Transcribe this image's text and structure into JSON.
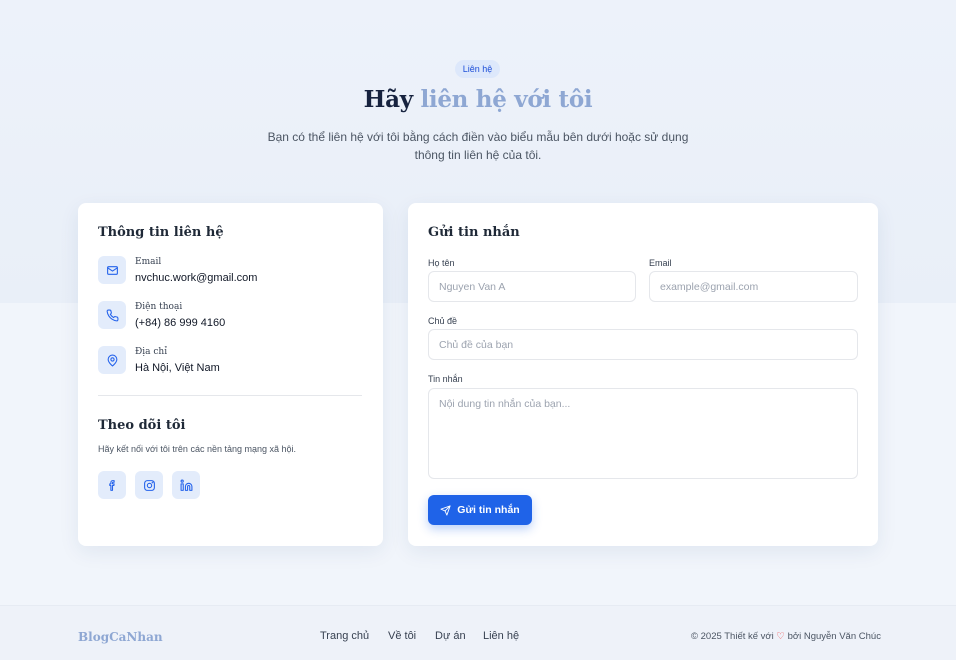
{
  "hero": {
    "badge": "Liên hệ",
    "title_plain": "Hãy ",
    "title_accent": "liên hệ với tôi",
    "subtitle_line1": "Bạn có thể liên hệ với tôi bằng cách điền vào biểu mẫu bên dưới hoặc sử dụng",
    "subtitle_line2": "thông tin liên hệ của tôi."
  },
  "contact_info": {
    "title": "Thông tin liên hệ",
    "items": [
      {
        "icon": "mail-icon",
        "label": "Email",
        "value": "nvchuc.work@gmail.com"
      },
      {
        "icon": "phone-icon",
        "label": "Điện thoại",
        "value": "(+84) 86 999 4160"
      },
      {
        "icon": "map-pin-icon",
        "label": "Địa chỉ",
        "value": "Hà Nội, Việt Nam"
      }
    ],
    "follow_title": "Theo dõi tôi",
    "follow_text": "Hãy kết nối với tôi trên các nền tảng mạng xã hội.",
    "socials": [
      "facebook-icon",
      "instagram-icon",
      "linkedin-icon"
    ]
  },
  "form": {
    "title": "Gửi tin nhắn",
    "name_label": "Họ tên",
    "name_placeholder": "Nguyen Van A",
    "email_label": "Email",
    "email_placeholder": "example@gmail.com",
    "subject_label": "Chủ đề",
    "subject_placeholder": "Chủ đề của bạn",
    "message_label": "Tin nhắn",
    "message_placeholder": "Nội dung tin nhắn của bạn...",
    "submit_label": "Gửi tin nhắn"
  },
  "footer": {
    "brand": "BlogCaNhan",
    "nav": [
      "Trang chủ",
      "Về tôi",
      "Dự án",
      "Liên hệ"
    ],
    "copyright_prefix": "© 2025 Thiết kế với",
    "heart": "♡",
    "copyright_suffix": "bởi Nguyễn Văn Chúc"
  },
  "colors": {
    "accent": "#1f63e8",
    "title_accent": "#8ea7d3",
    "icon_bg": "#e3ecfb"
  }
}
